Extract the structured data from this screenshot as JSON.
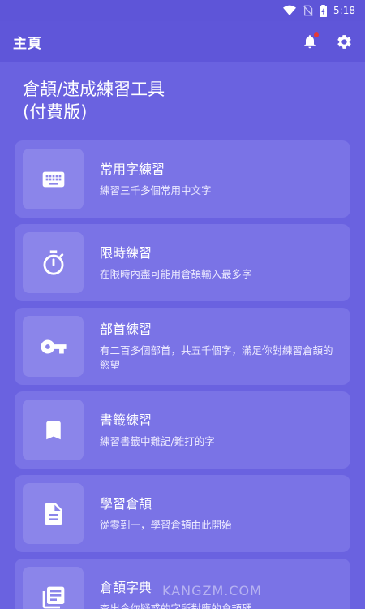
{
  "status": {
    "time": "5:18"
  },
  "app_bar": {
    "title": "主頁"
  },
  "headline": "倉頡/速成練習工具\n(付費版)",
  "cards": [
    {
      "title": "常用字練習",
      "description": "練習三千多個常用中文字",
      "icon": "keyboard-icon"
    },
    {
      "title": "限時練習",
      "description": "在限時內盡可能用倉頡輸入最多字",
      "icon": "timer-icon"
    },
    {
      "title": "部首練習",
      "description": "有二百多個部首，共五千個字，滿足你對練習倉頡的慾望",
      "icon": "key-icon"
    },
    {
      "title": "書籤練習",
      "description": "練習書籤中難記/難打的字",
      "icon": "bookmark-icon"
    },
    {
      "title": "學習倉頡",
      "description": "從零到一，學習倉頡由此開始",
      "icon": "document-icon"
    },
    {
      "title": "倉頡字典",
      "description": "查出令你疑惑的字所對應的倉頡碼",
      "icon": "list-icon"
    }
  ],
  "watermark": "KANGZM.COM",
  "colors": {
    "background": "#6a62e0",
    "card": "#7a73e6",
    "card_icon_bg": "#8b85ea",
    "notification_dot": "#e53935"
  }
}
